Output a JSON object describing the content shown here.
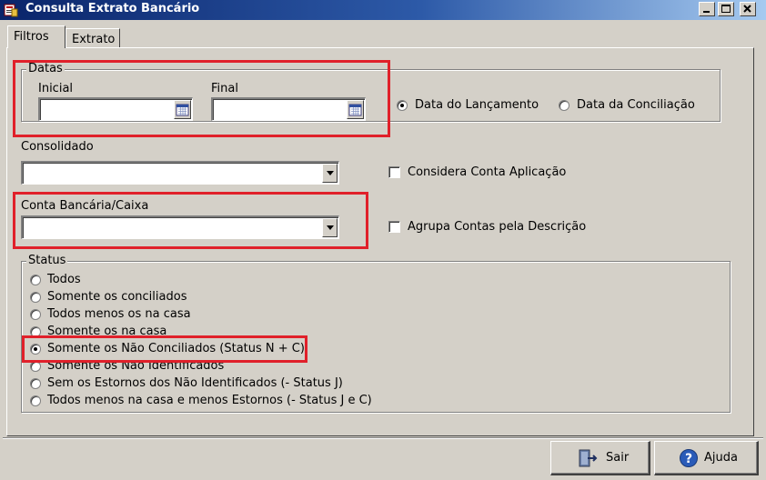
{
  "window": {
    "title": "Consulta Extrato Bancário"
  },
  "tabs": [
    {
      "label": "Filtros"
    },
    {
      "label": "Extrato"
    }
  ],
  "datas": {
    "legend": "Datas",
    "inicial_label": "Inicial",
    "inicial_value": "",
    "final_label": "Final",
    "final_value": "",
    "date_type_options": [
      "Data do Lançamento",
      "Data da Conciliação"
    ],
    "date_type_selected": "Data do Lançamento"
  },
  "consolidado": {
    "label": "Consolidado",
    "value": ""
  },
  "conta": {
    "label": "Conta Bancária/Caixa",
    "value": ""
  },
  "checkboxes": {
    "considera_conta_aplicacao": {
      "label": "Considera Conta Aplicação",
      "checked": false
    },
    "agrupa_contas_descricao": {
      "label": "Agrupa Contas pela Descrição",
      "checked": false
    }
  },
  "status": {
    "legend": "Status",
    "options": [
      "Todos",
      "Somente os conciliados",
      "Todos menos os na casa",
      "Somente os na casa",
      "Somente os Não Conciliados (Status N + C)",
      "Somente os Não Identificados",
      "Sem os Estornos dos Não Identificados (- Status J)",
      "Todos menos na casa e menos Estornos (- Status J e C)"
    ],
    "selected": "Somente os Não Conciliados (Status N + C)"
  },
  "buttons": {
    "sair": "Sair",
    "ajuda": "Ajuda"
  },
  "colors": {
    "highlight": "#e0202a",
    "titlebar": "#0a246a",
    "face": "#d4d0c8"
  },
  "icons": {
    "window": "app-icon",
    "sair": "exit-door-icon",
    "ajuda": "help-question-icon",
    "calendar": "calendar-icon"
  }
}
